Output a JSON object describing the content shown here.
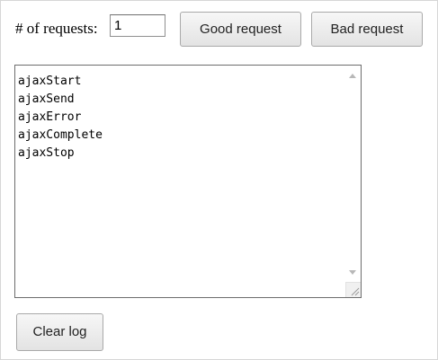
{
  "controls": {
    "requests_label": "# of requests:",
    "requests_value": "1",
    "good_request_label": "Good request",
    "bad_request_label": "Bad request",
    "clear_log_label": "Clear log"
  },
  "log": {
    "lines": [
      "ajaxStart",
      "ajaxSend",
      "ajaxError",
      "ajaxComplete",
      "ajaxStop"
    ]
  },
  "icons": {
    "scroll_up": "scroll-up-arrow",
    "scroll_down": "scroll-down-arrow",
    "resize": "resize-grip"
  }
}
